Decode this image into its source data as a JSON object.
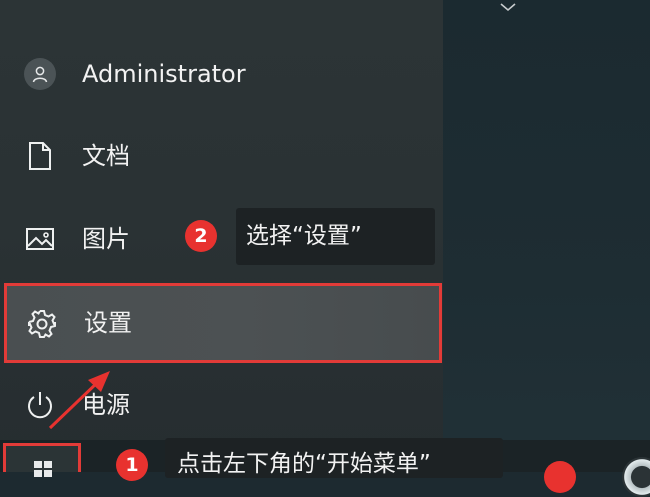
{
  "start_menu": {
    "user": {
      "name": "Administrator",
      "icon": "user-avatar-icon"
    },
    "items": [
      {
        "label": "文档",
        "icon": "document-icon"
      },
      {
        "label": "图片",
        "icon": "picture-icon"
      },
      {
        "label": "设置",
        "icon": "gear-icon"
      },
      {
        "label": "电源",
        "icon": "power-icon"
      }
    ],
    "expand_icon": "chevron-down-icon"
  },
  "annotations": {
    "step1": {
      "number": "1",
      "text": "点击左下角的“开始菜单”"
    },
    "step2": {
      "number": "2",
      "text": "选择“设置”"
    },
    "highlight_color": "#e23b38"
  },
  "taskbar": {
    "start_icon": "windows-logo-icon",
    "pinned_icon": "edge-browser-icon"
  }
}
